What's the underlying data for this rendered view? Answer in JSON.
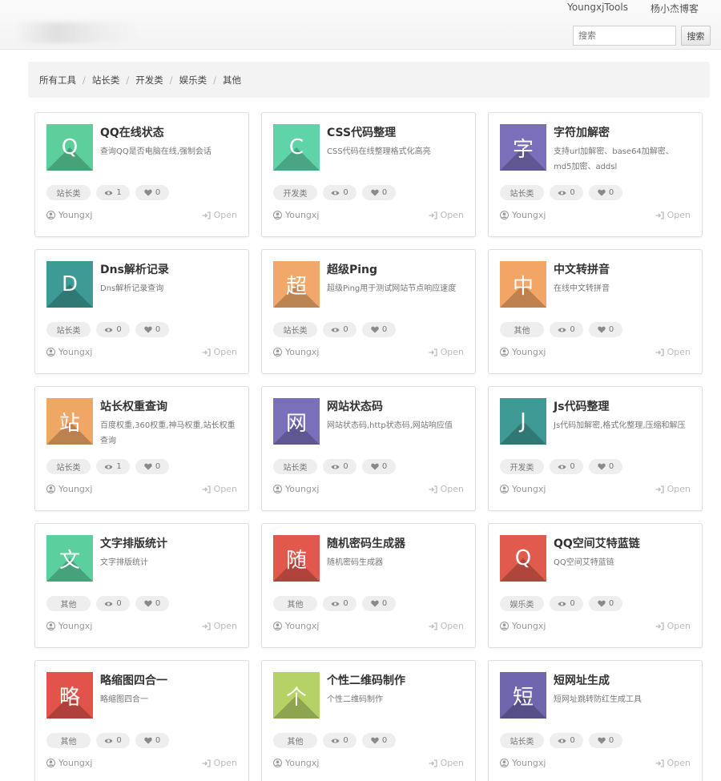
{
  "header": {
    "nav": [
      "YoungxjTools",
      "杨小杰博客"
    ],
    "search_placeholder": "搜索",
    "search_button": "搜索"
  },
  "breadcrumb": [
    "所有工具",
    "站长类",
    "开发类",
    "娱乐类",
    "其他"
  ],
  "card_footer": {
    "author": "Youngxj",
    "open_label": "Open"
  },
  "tools": [
    {
      "glyph": "Q",
      "title": "QQ在线状态",
      "desc": "查询QQ是否电脑在线,强制会话",
      "category": "站长类",
      "views": "1",
      "likes": "0",
      "color": "#5ccf9c"
    },
    {
      "glyph": "C",
      "title": "CSS代码整理",
      "desc": "CSS代码在线整理格式化高亮",
      "category": "开发类",
      "views": "0",
      "likes": "0",
      "color": "#5fd4a9"
    },
    {
      "glyph": "字",
      "title": "字符加解密",
      "desc": "支持url加解密、base64加解密、md5加密、addsl",
      "category": "站长类",
      "views": "0",
      "likes": "0",
      "color": "#7b6fbb"
    },
    {
      "glyph": "D",
      "title": "Dns解析记录",
      "desc": "Dns解析记录查询",
      "category": "站长类",
      "views": "0",
      "likes": "0",
      "color": "#3e9a94"
    },
    {
      "glyph": "超",
      "title": "超级Ping",
      "desc": "超级Ping用于测试网站节点响应速度",
      "category": "站长类",
      "views": "0",
      "likes": "0",
      "color": "#f0a96b"
    },
    {
      "glyph": "中",
      "title": "中文转拼音",
      "desc": "在线中文转拼音",
      "category": "其他",
      "views": "0",
      "likes": "0",
      "color": "#f2a565"
    },
    {
      "glyph": "站",
      "title": "站长权重查询",
      "desc": "百度权重,360权重,神马权重,站长权重查询",
      "category": "站长类",
      "views": "1",
      "likes": "0",
      "color": "#f0a664"
    },
    {
      "glyph": "网",
      "title": "网站状态码",
      "desc": "网站状态码,http状态码,网站响应值",
      "category": "站长类",
      "views": "0",
      "likes": "0",
      "color": "#7a70ba"
    },
    {
      "glyph": "J",
      "title": "Js代码整理",
      "desc": "Js代码加解密,格式化整理,压缩和解压",
      "category": "开发类",
      "views": "0",
      "likes": "0",
      "color": "#3f9994"
    },
    {
      "glyph": "文",
      "title": "文字排版统计",
      "desc": "文字排版统计",
      "category": "其他",
      "views": "0",
      "likes": "0",
      "color": "#5bcf9e"
    },
    {
      "glyph": "随",
      "title": "随机密码生成器",
      "desc": "随机密码生成器",
      "category": "其他",
      "views": "0",
      "likes": "0",
      "color": "#e2584d"
    },
    {
      "glyph": "Q",
      "title": "QQ空间艾特蓝链",
      "desc": "QQ空间艾特蓝链",
      "category": "娱乐类",
      "views": "0",
      "likes": "0",
      "color": "#e05a4e"
    },
    {
      "glyph": "略",
      "title": "略缩图四合一",
      "desc": "略缩图四合一",
      "category": "其他",
      "views": "0",
      "likes": "0",
      "color": "#e2544b"
    },
    {
      "glyph": "个",
      "title": "个性二维码制作",
      "desc": "个性二维码制作",
      "category": "其他",
      "views": "0",
      "likes": "0",
      "color": "#b6d267"
    },
    {
      "glyph": "短",
      "title": "短网址生成",
      "desc": "短网址跳转防红生成工具",
      "category": "站长类",
      "views": "0",
      "likes": "0",
      "color": "#6f66ae"
    }
  ]
}
